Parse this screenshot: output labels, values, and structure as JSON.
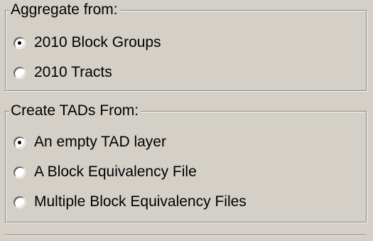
{
  "aggregate": {
    "legend": "Aggregate from:",
    "options": [
      {
        "label": "2010 Block Groups",
        "checked": true
      },
      {
        "label": "2010 Tracts",
        "checked": false
      }
    ]
  },
  "create": {
    "legend": "Create TADs From:",
    "options": [
      {
        "label": "An empty TAD layer",
        "checked": true
      },
      {
        "label": "A Block Equivalency File",
        "checked": false
      },
      {
        "label": "Multiple Block Equivalency Files",
        "checked": false
      }
    ]
  },
  "colors": {
    "background": "#d4d0c8",
    "shadow": "#808080",
    "highlight": "#ffffff"
  }
}
